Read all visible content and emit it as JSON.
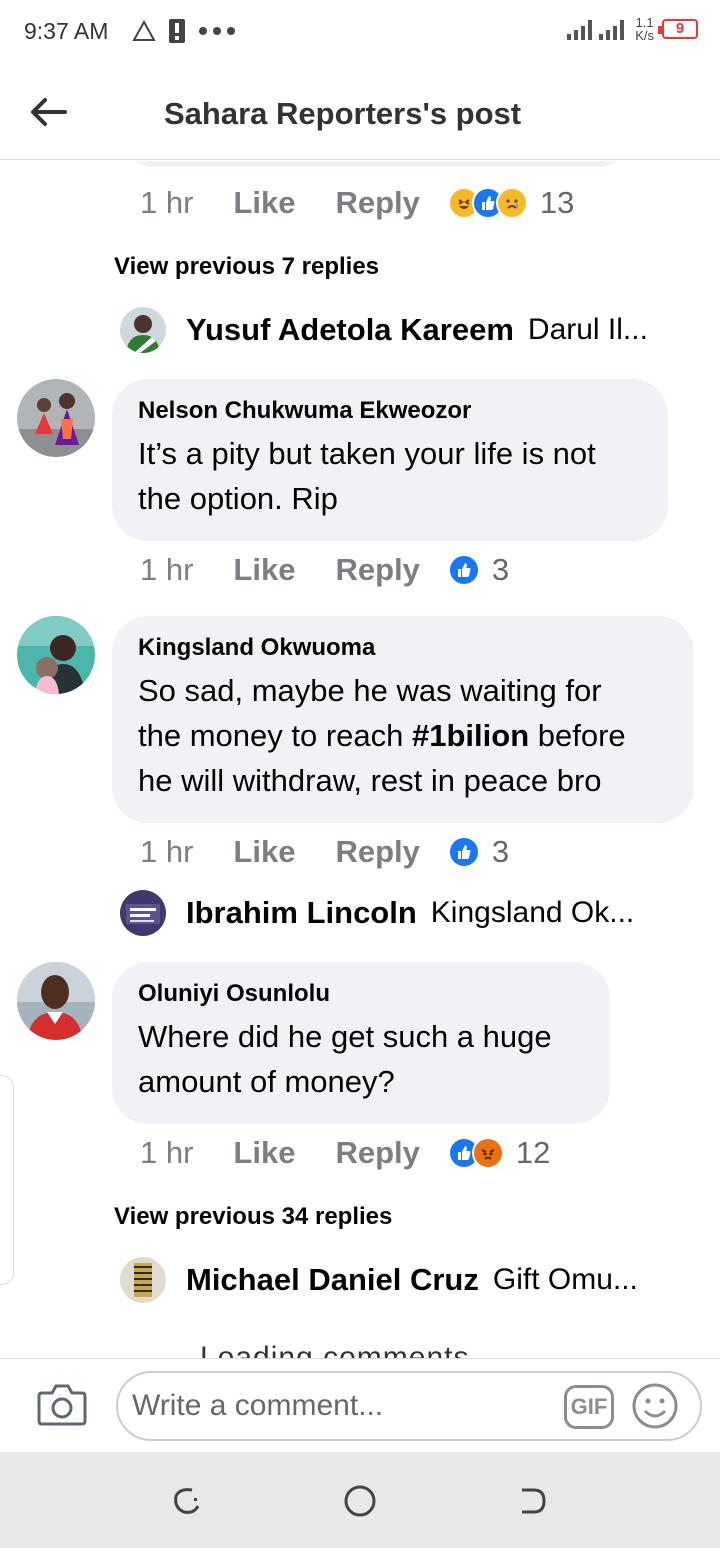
{
  "status": {
    "time": "9:37 AM",
    "speed_value": "1.1",
    "speed_unit": "K/s",
    "battery": "9"
  },
  "header": {
    "title": "Sahara Reporters's post"
  },
  "threads": {
    "top_meta": {
      "time": "1 hr",
      "like": "Like",
      "reply": "Reply",
      "count": "13"
    },
    "view_prev_1": "View previous 7 replies",
    "reply_1": {
      "name": "Yusuf Adetola Kareem",
      "text": "Darul Il..."
    },
    "comment_1": {
      "name": "Nelson Chukwuma Ekweozor",
      "line1": "It’s a pity but taken your life is not",
      "line2": "the option. Rip",
      "meta": {
        "time": "1 hr",
        "like": "Like",
        "reply": "Reply",
        "count": "3"
      }
    },
    "comment_2": {
      "name": "Kingsland Okwuoma",
      "line1": "So sad, maybe he was waiting for",
      "line2_pre": "the money to reach ",
      "line2_bold": "#1bilion",
      "line2_post": " before",
      "line3": "he will withdraw, rest in peace bro",
      "meta": {
        "time": "1 hr",
        "like": "Like",
        "reply": "Reply",
        "count": "3"
      }
    },
    "reply_2": {
      "name": "Ibrahim Lincoln",
      "text": "Kingsland Ok..."
    },
    "comment_3": {
      "name": "Oluniyi Osunlolu",
      "line1": "Where did he get such a huge",
      "line2": "amount of money?",
      "meta": {
        "time": "1 hr",
        "like": "Like",
        "reply": "Reply",
        "count": "12"
      }
    },
    "view_prev_2": "View previous 34 replies",
    "reply_3": {
      "name": "Michael Daniel Cruz",
      "text": "Gift Omu..."
    },
    "loading": "Loading comments"
  },
  "composer": {
    "placeholder": "Write a comment...",
    "gif": "GIF"
  },
  "colors": {
    "like_blue": "#1877f2",
    "bubble_bg": "#f0f2f5",
    "muted": "#65676b"
  }
}
